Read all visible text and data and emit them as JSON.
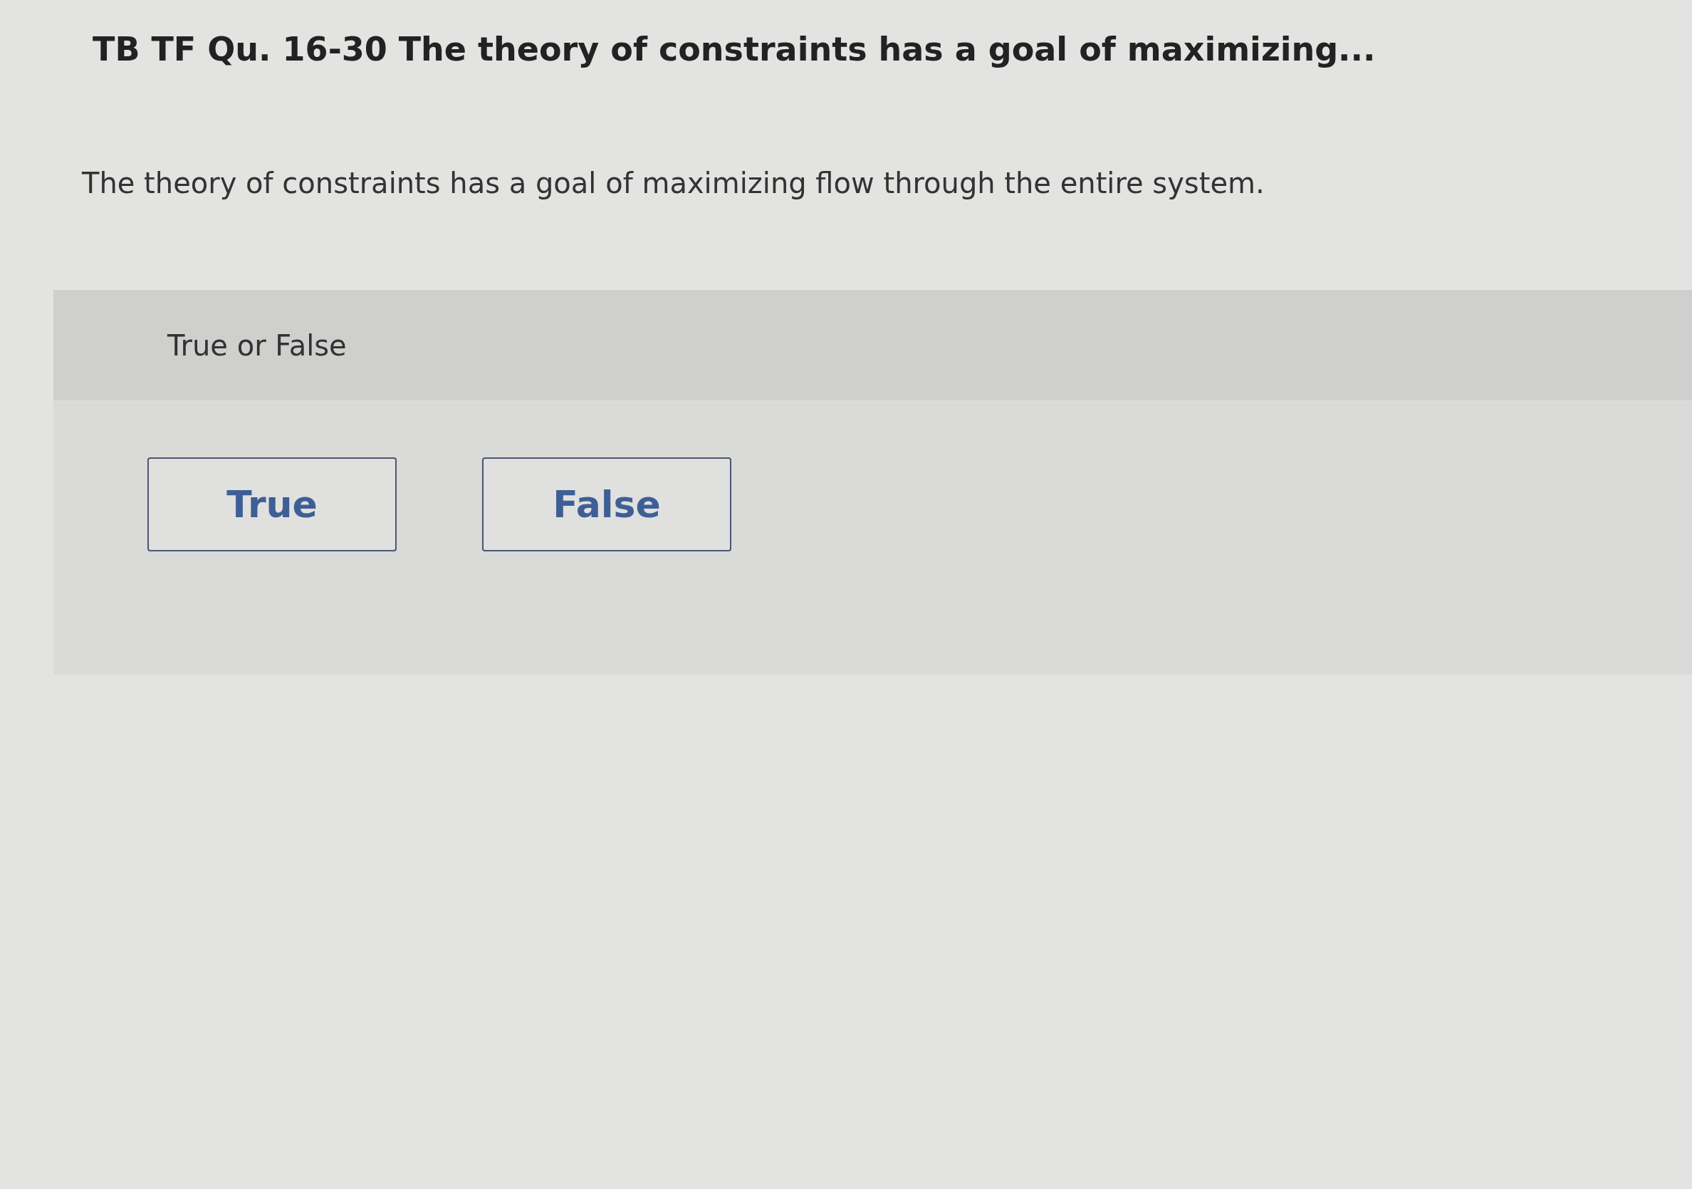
{
  "question": {
    "title": "TB TF Qu. 16-30 The theory of constraints has a goal of maximizing...",
    "prompt": "The theory of constraints has a goal of maximizing flow through the entire system."
  },
  "answer_panel": {
    "heading": "True or False",
    "options": [
      {
        "label": "True",
        "selected": false
      },
      {
        "label": "False",
        "selected": false
      }
    ]
  }
}
